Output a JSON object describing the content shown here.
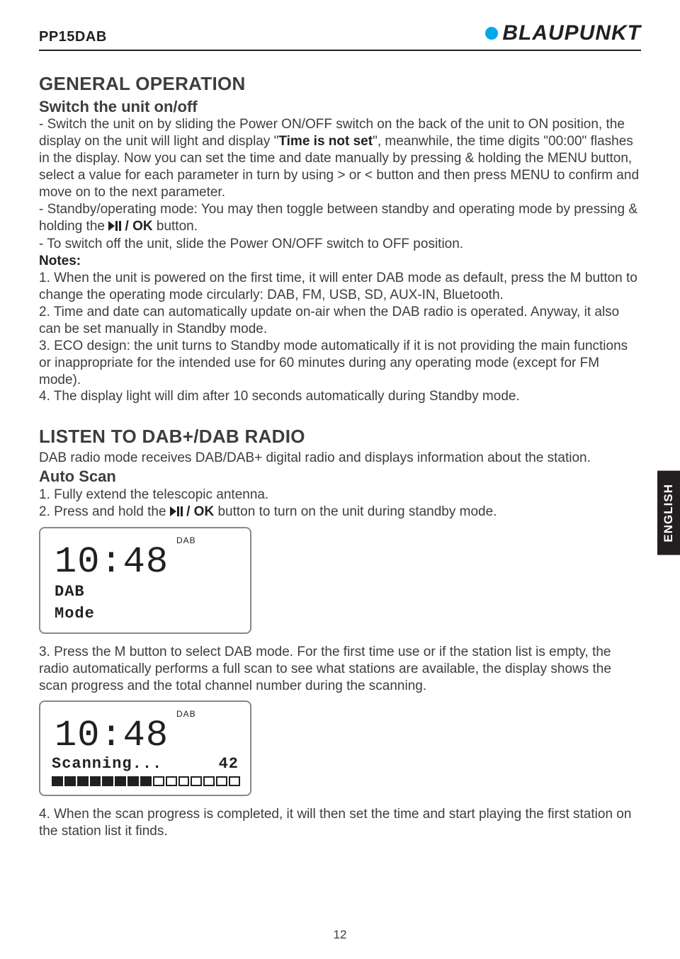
{
  "header": {
    "model": "PP15DAB",
    "brand": "BLAUPUNKT"
  },
  "sidebar": {
    "language": "ENGLISH"
  },
  "page_number": "12",
  "section1": {
    "title": "GENERAL OPERATION",
    "subtitle": "Switch the unit on/off",
    "p1a": "- Switch the unit on by sliding the Power ON/OFF switch on the back of the unit to ON position, the display on the unit will light and display \"",
    "p1b": "Time is not set",
    "p1c": "\", meanwhile, the time digits \"00:00\" flashes in the display. Now you can set the time and date manually by pressing & holding the MENU button, select a value for each parameter in turn by using > or < button and then press MENU to confirm and move on to the next parameter.",
    "p2a": "- Standby/operating mode: You may then toggle between standby and operating mode by pressing & holding the ",
    "p2b": " / OK",
    "p2c": " button.",
    "p3": "- To switch off the unit, slide the Power ON/OFF switch to OFF position.",
    "notes_label": "Notes:",
    "n1": "1. When the unit is powered on the first time, it will enter DAB mode as default, press the M button to change the operating mode circularly: DAB, FM, USB, SD, AUX-IN, Bluetooth.",
    "n2": "2. Time and date can automatically update on-air when the DAB radio is operated. Anyway, it also can be set manually in Standby mode.",
    "n3": "3. ECO design: the unit turns to Standby mode automatically if it is not providing the main functions or inappropriate for the intended use for 60 minutes during any operating mode (except for FM mode).",
    "n4": "4. The display light will dim after 10 seconds automatically during Standby mode."
  },
  "section2": {
    "title": "LISTEN TO DAB+/DAB RADIO",
    "intro": "DAB radio mode receives DAB/DAB+ digital radio and displays information about the station.",
    "autoscan": "Auto Scan",
    "s1": "1. Fully extend the telescopic antenna.",
    "s2a": "2. Press and hold the ",
    "s2b": " / OK",
    "s2c": " button to turn on the unit during standby mode.",
    "s3": "3. Press the M button to select DAB mode. For the first time use or if the station list is empty, the radio automatically performs a full scan to see what stations are available, the display shows the scan progress and the total channel number during the scanning.",
    "s4": "4. When the scan progress is completed, it will then set the time and start playing the first station on the station list it finds."
  },
  "lcd1": {
    "tag": "DAB",
    "time": "10:48",
    "line1": "DAB",
    "line2": "Mode"
  },
  "lcd2": {
    "tag": "DAB",
    "time": "10:48",
    "line1": "Scanning...",
    "count": "42"
  }
}
